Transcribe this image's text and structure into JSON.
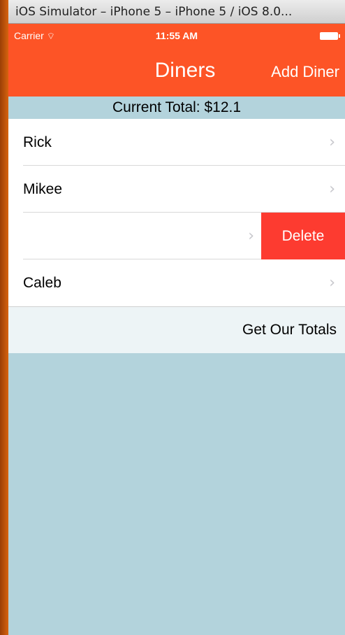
{
  "window": {
    "title": "iOS Simulator – iPhone 5 – iPhone 5 / iOS 8.0..."
  },
  "statusbar": {
    "carrier": "Carrier",
    "time": "11:55 AM",
    "wifi_icon": "wifi-icon",
    "battery_icon": "battery-icon"
  },
  "navbar": {
    "title": "Diners",
    "add_button": "Add Diner",
    "color": "#fd5426"
  },
  "total": {
    "label": "Current Total: $12.1"
  },
  "diners": [
    {
      "name": "Rick"
    },
    {
      "name": "Mikee"
    },
    {
      "name": ""
    },
    {
      "name": "Caleb"
    }
  ],
  "row_chevron": "›",
  "delete_label": "Delete",
  "delete_color": "#fd3b30",
  "totals_button": "Get Our Totals"
}
